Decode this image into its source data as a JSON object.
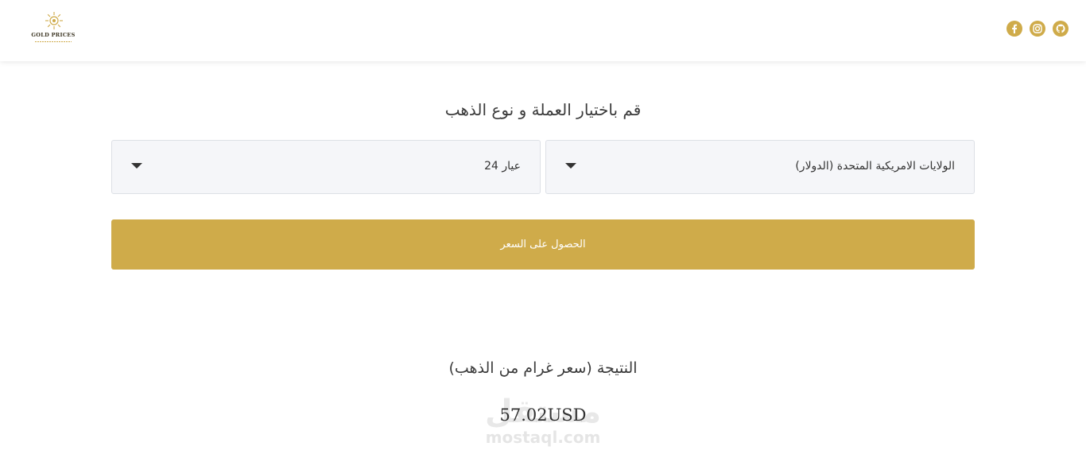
{
  "colors": {
    "accent": "#cfab4a",
    "select_bg": "#f5f6f9",
    "text": "#3b3b3b"
  },
  "header": {
    "logo": {
      "title": "GOLD PRICES",
      "icon": "sun-logo-icon"
    },
    "social_icons": [
      "facebook-icon",
      "instagram-icon",
      "github-icon"
    ]
  },
  "form": {
    "heading": "قم باختيار العملة و نوع الذهب",
    "currency_select": {
      "value": "الولايات الامريكية المتحدة (الدولار)"
    },
    "karat_select": {
      "value": "عيار 24"
    },
    "submit_label": "الحصول على السعر"
  },
  "result": {
    "heading": "النتيجة (سعر غرام من الذهب)",
    "value": "57.02USD"
  },
  "watermark": {
    "arabic": "مستقل",
    "latin": "mostaql.com"
  }
}
